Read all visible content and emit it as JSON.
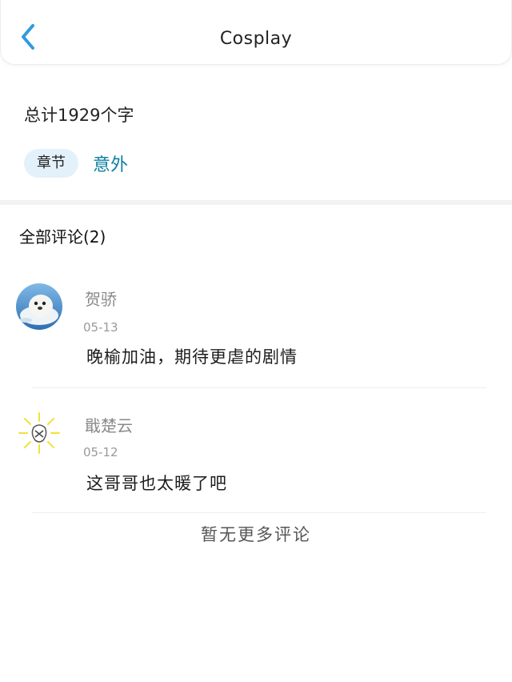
{
  "header": {
    "title": "Cosplay",
    "back_icon": "chevron-left-icon",
    "back_color": "#2f9be0"
  },
  "summary": {
    "total_words": "总计1929个字",
    "chapter_tag": "章节",
    "chapter_name": "意外"
  },
  "comments_section": {
    "heading": "全部评论(2)",
    "items": [
      {
        "name": "贺骄",
        "date": "05-13",
        "text": "晚榆加油，期待更虐的剧情",
        "avatar": "seal-avatar"
      },
      {
        "name": "戢楚云",
        "date": "05-12",
        "text": "这哥哥也太暖了吧",
        "avatar": "doodle-avatar"
      }
    ],
    "footer": "暂无更多评论"
  },
  "colors": {
    "accent": "#2f9be0",
    "chapter_link": "#0e7fa0",
    "tag_bg": "#e3f1fb"
  }
}
